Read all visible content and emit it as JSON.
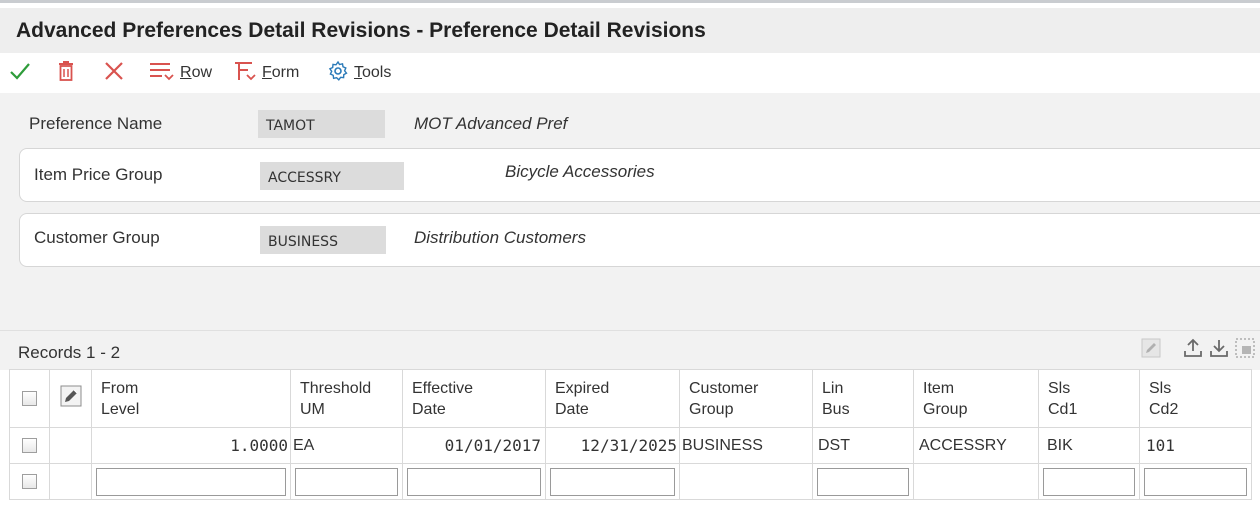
{
  "title": "Advanced Preferences Detail Revisions - Preference Detail Revisions",
  "toolbar": {
    "row_label_first": "R",
    "row_label_rest": "ow",
    "form_label_first": "F",
    "form_label_rest": "orm",
    "tools_label_first": "T",
    "tools_label_rest": "ools"
  },
  "form": {
    "preference_name": {
      "label": "Preference Name",
      "value": "TAMOT",
      "description": "MOT Advanced Pref"
    },
    "item_price_group": {
      "label": "Item Price Group",
      "value": "ACCESSRY",
      "description": "Bicycle Accessories"
    },
    "customer_group": {
      "label": "Customer Group",
      "value": "BUSINESS",
      "description": "Distribution Customers"
    }
  },
  "grid": {
    "records_label": "Records 1 - 2",
    "columns": [
      {
        "line1": "From",
        "line2": "Level"
      },
      {
        "line1": "Threshold",
        "line2": "UM"
      },
      {
        "line1": "Effective",
        "line2": "Date"
      },
      {
        "line1": "Expired",
        "line2": "Date"
      },
      {
        "line1": "Customer",
        "line2": "Group"
      },
      {
        "line1": "Lin",
        "line2": "Bus"
      },
      {
        "line1": "Item",
        "line2": "Group"
      },
      {
        "line1": "Sls",
        "line2": "Cd1"
      },
      {
        "line1": "Sls",
        "line2": "Cd2"
      }
    ],
    "rows": [
      {
        "from_level": "1.0000",
        "threshold_um": "EA",
        "effective_date": "01/01/2017",
        "expired_date": "12/31/2025",
        "customer_group": "BUSINESS",
        "lin_bus": "DST",
        "item_group": "ACCESSRY",
        "sls_cd1": "BIK",
        "sls_cd2": "101"
      }
    ]
  },
  "colors": {
    "title_bg": "#eeeeee",
    "form_bg": "#f2f2f2",
    "ok_green": "#2e9c3a",
    "delete_red": "#d9534f",
    "tools_blue": "#2a7ab8"
  },
  "icons": {
    "ok": "checkmark-icon",
    "delete": "trash-icon",
    "cancel": "close-icon",
    "row": "row-menu-icon",
    "form": "form-menu-icon",
    "tools": "gear-icon"
  }
}
